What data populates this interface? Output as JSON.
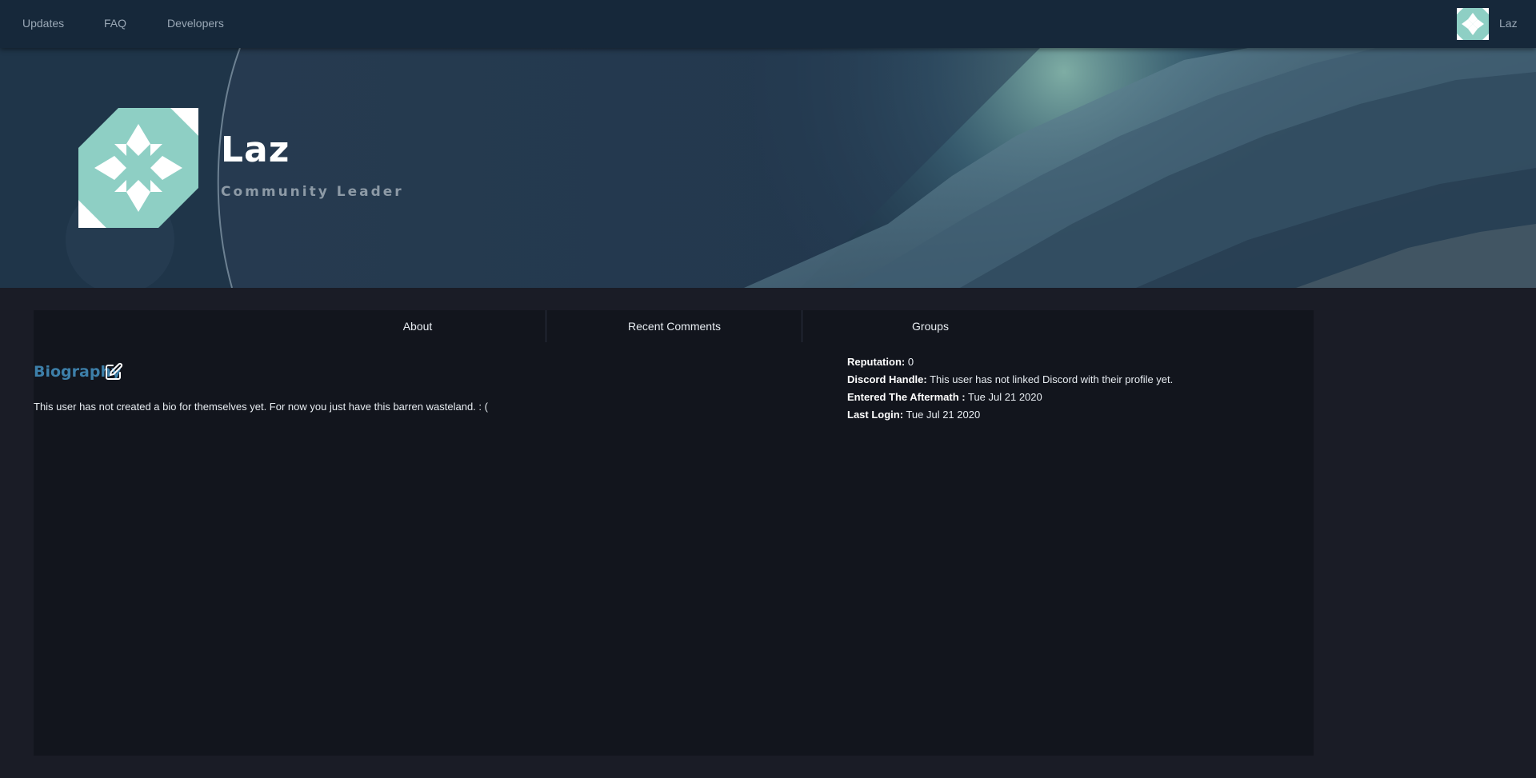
{
  "nav": {
    "links": [
      "Updates",
      "FAQ",
      "Developers"
    ],
    "username": "Laz"
  },
  "profile": {
    "name": "Laz",
    "role": "Community Leader"
  },
  "tabs": [
    "About",
    "Recent Comments",
    "Groups"
  ],
  "bio": {
    "title": "Biography",
    "text": "This user has not created a bio for themselves yet. For now you just have this barren wasteland. : ("
  },
  "stats": {
    "reputation_label": "Reputation:",
    "reputation_value": "0",
    "discord_label": "Discord Handle:",
    "discord_value": "This user has not linked Discord with their profile yet.",
    "entered_label": "Entered The Aftermath :",
    "entered_value": "Tue Jul 21 2020",
    "login_label": "Last Login:",
    "login_value": "Tue Jul 21 2020"
  },
  "colors": {
    "identicon": "#8ecfc4",
    "accent": "#3d7fa9",
    "nav_bg": "#16283a",
    "card_bg": "#12151d"
  }
}
